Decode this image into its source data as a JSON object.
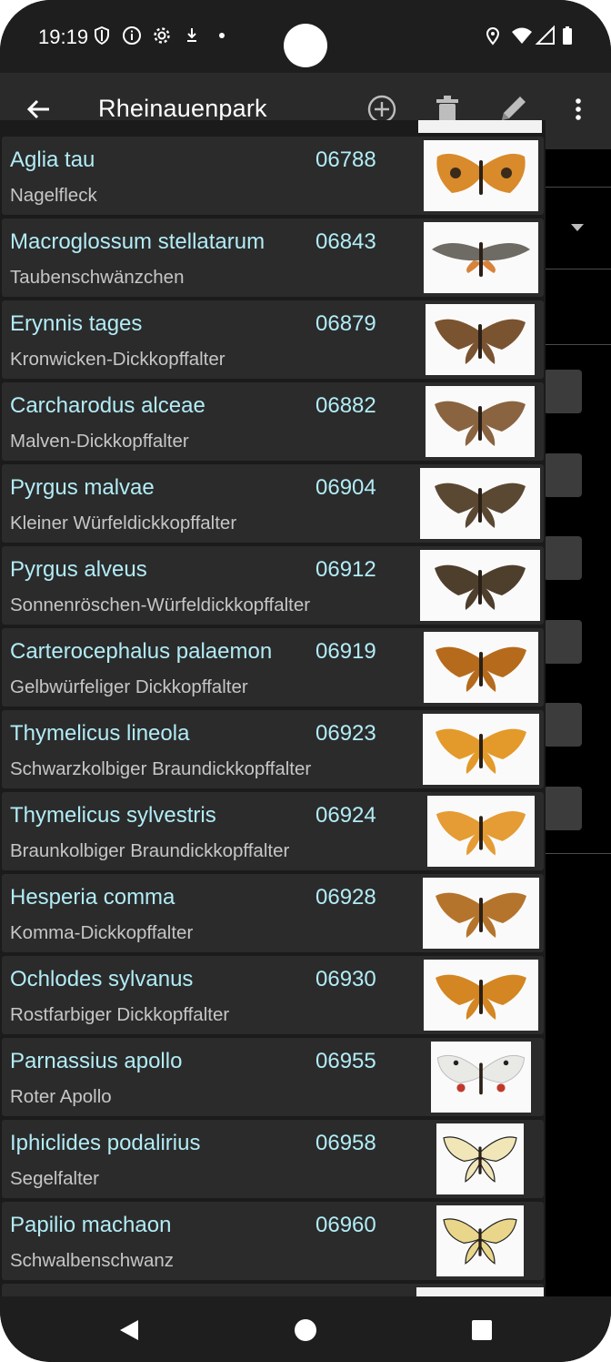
{
  "status_bar": {
    "time": "19:19",
    "left_icons": [
      "shield-icon",
      "info-icon",
      "settings-icon",
      "download-icon",
      "dot-icon"
    ],
    "right_icons": [
      "location-icon",
      "wifi-icon",
      "signal-icon",
      "battery-icon"
    ]
  },
  "app_bar": {
    "title": "Rheinauenpark",
    "actions": [
      "add-circle-icon",
      "trash-icon",
      "pencil-icon",
      "more-vert-icon"
    ]
  },
  "species_list": [
    {
      "scientific": "Aglia tau",
      "number": "06788",
      "common": "Nagelfleck",
      "thumb_color": "#d98a2b",
      "wing_shape": "moth"
    },
    {
      "scientific": "Macroglossum stellatarum",
      "number": "06843",
      "common": "Taubenschwänzchen",
      "thumb_color": "#6e6a64",
      "wing_shape": "hawk"
    },
    {
      "scientific": "Erynnis tages",
      "number": "06879",
      "common": "Kronwicken-Dickkopffalter",
      "thumb_color": "#7a5330",
      "wing_shape": "skipper"
    },
    {
      "scientific": "Carcharodus alceae",
      "number": "06882",
      "common": "Malven-Dickkopffalter",
      "thumb_color": "#8a6440",
      "wing_shape": "skipper"
    },
    {
      "scientific": "Pyrgus malvae",
      "number": "06904",
      "common": "Kleiner Würfeldickkopffalter",
      "thumb_color": "#5a4832",
      "wing_shape": "skipper"
    },
    {
      "scientific": "Pyrgus alveus",
      "number": "06912",
      "common": "Sonnenröschen-Würfeldickkopffalter",
      "thumb_color": "#4e3e2c",
      "wing_shape": "skipper"
    },
    {
      "scientific": "Carterocephalus palaemon",
      "number": "06919",
      "common": "Gelbwürfeliger Dickkopffalter",
      "thumb_color": "#b66a1c",
      "wing_shape": "skipper"
    },
    {
      "scientific": "Thymelicus lineola",
      "number": "06923",
      "common": "Schwarzkolbiger Braundickkopffalter",
      "thumb_color": "#e39a2a",
      "wing_shape": "skipper"
    },
    {
      "scientific": "Thymelicus sylvestris",
      "number": "06924",
      "common": "Braunkolbiger Braundickkopffalter",
      "thumb_color": "#e59c34",
      "wing_shape": "skipper"
    },
    {
      "scientific": "Hesperia comma",
      "number": "06928",
      "common": "Komma-Dickkopffalter",
      "thumb_color": "#b5742c",
      "wing_shape": "skipper"
    },
    {
      "scientific": "Ochlodes sylvanus",
      "number": "06930",
      "common": "Rostfarbiger Dickkopffalter",
      "thumb_color": "#d48622",
      "wing_shape": "skipper"
    },
    {
      "scientific": "Parnassius apollo",
      "number": "06955",
      "common": "Roter Apollo",
      "thumb_color": "#e9e9e6",
      "wing_shape": "apollo"
    },
    {
      "scientific": "Iphiclides podalirius",
      "number": "06958",
      "common": "Segelfalter",
      "thumb_color": "#f0e6b8",
      "wing_shape": "swallowtail"
    },
    {
      "scientific": "Papilio machaon",
      "number": "06960",
      "common": "Schwalbenschwanz",
      "thumb_color": "#ead68a",
      "wing_shape": "swallowtail"
    }
  ],
  "nav_bar": {
    "buttons": [
      "back-triangle-icon",
      "home-circle-icon",
      "recents-square-icon"
    ]
  },
  "colors": {
    "scientific_name": "#b2ecf6",
    "common_name": "#c6c6c6",
    "row_background": "#2b2b2b",
    "app_bar": "#2a2a2a"
  }
}
